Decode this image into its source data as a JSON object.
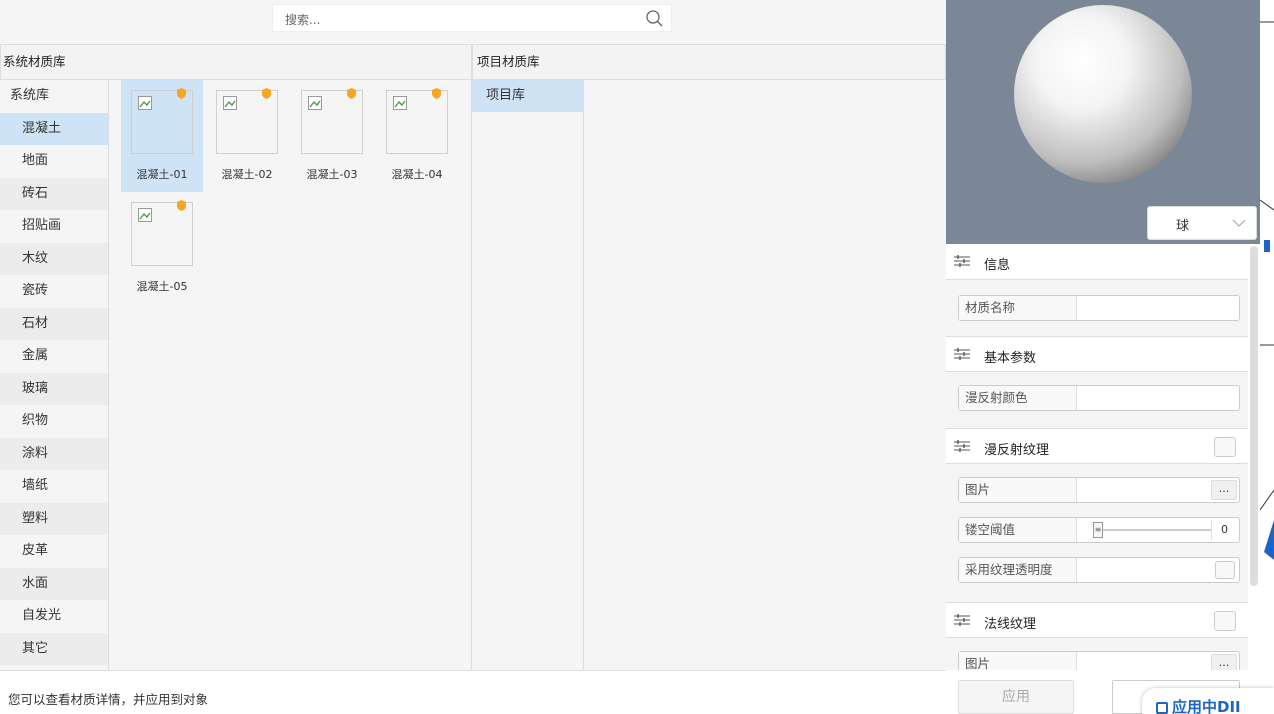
{
  "search": {
    "placeholder": "搜索..."
  },
  "system_library": {
    "header": "系统材质库",
    "root_label": "系统库",
    "categories": [
      "混凝土",
      "地面",
      "砖石",
      "招贴画",
      "木纹",
      "瓷砖",
      "石材",
      "金属",
      "玻璃",
      "织物",
      "涂料",
      "墙纸",
      "塑料",
      "皮革",
      "水面",
      "自发光",
      "其它"
    ],
    "selected_category": "混凝土",
    "materials": [
      "混凝土-01",
      "混凝土-02",
      "混凝土-03",
      "混凝土-04",
      "混凝土-05"
    ],
    "selected_material": "混凝土-01"
  },
  "project_library": {
    "header": "项目材质库",
    "items": [
      "项目库"
    ]
  },
  "preview": {
    "shape": "球"
  },
  "properties": {
    "info": {
      "title": "信息",
      "material_name_label": "材质名称",
      "material_name_value": ""
    },
    "basic": {
      "title": "基本参数",
      "diffuse_color_label": "漫反射颜色"
    },
    "diffuse_texture": {
      "title": "漫反射纹理",
      "image_label": "图片",
      "browse": "...",
      "cutout_label": "镂空阈值",
      "cutout_value": "0",
      "use_alpha_label": "采用纹理透明度"
    },
    "normal_texture": {
      "title": "法线纹理",
      "image_label": "图片",
      "browse": "..."
    }
  },
  "status": {
    "hint": "您可以查看材质详情，并应用到对象"
  },
  "buttons": {
    "apply": "应用",
    "apply_in_dialog": "应用中DII"
  },
  "colors": {
    "selection": "#cfe3f7",
    "preview_bg": "#7b8797",
    "accent": "#1f63c7",
    "badge": "#f5a623"
  }
}
